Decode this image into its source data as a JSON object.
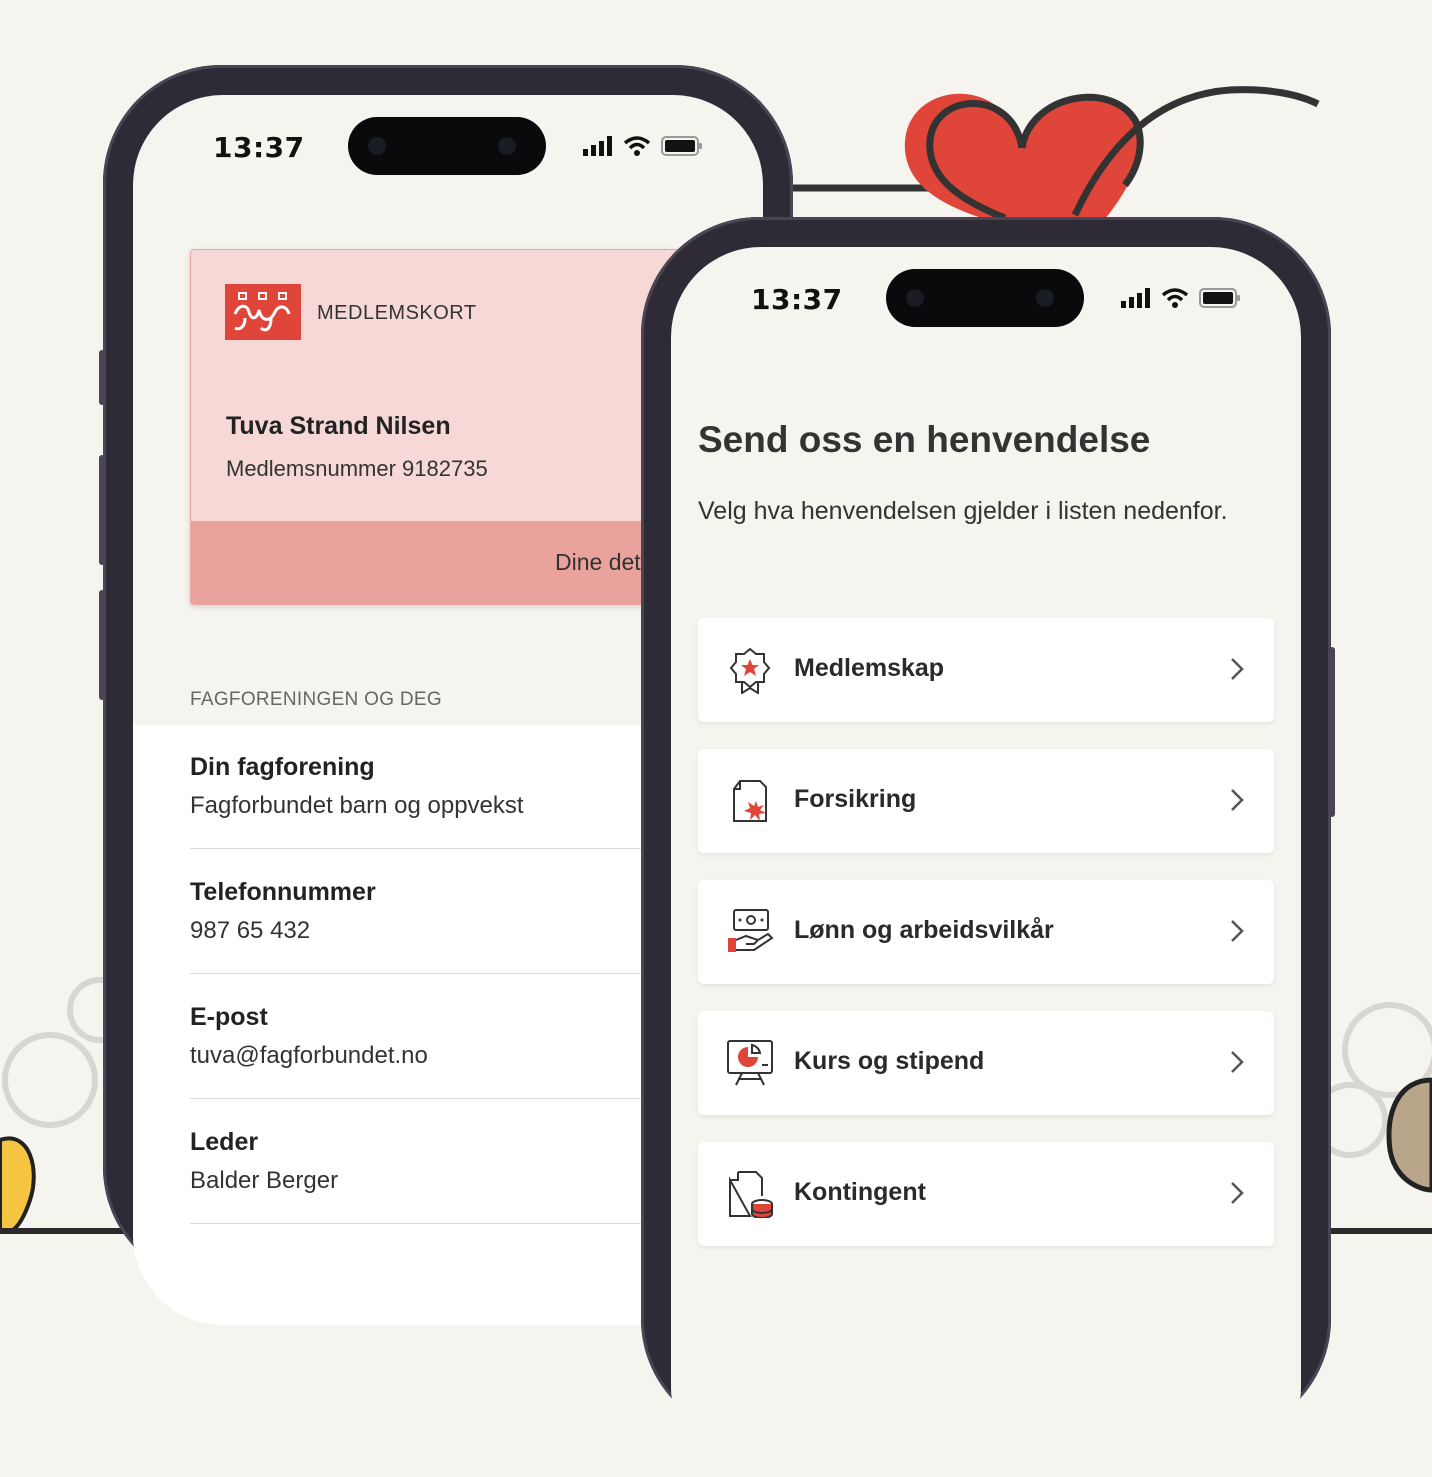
{
  "colors": {
    "accent": "#e0453a",
    "card_bg": "#f6d8d7",
    "card_footer": "#eaa29c",
    "background": "#f6f4ef",
    "phone_frame": "#2e2a36"
  },
  "phone_left": {
    "status_time": "13:37",
    "membership_card": {
      "label": "MEDLEMSKORT",
      "name": "Tuva Strand Nilsen",
      "member_number": "Medlemsnummer 9182735",
      "footer_link": "Dine detalj"
    },
    "section_heading": "FAGFORENINGEN OG DEG",
    "rows": [
      {
        "label": "Din fagforening",
        "value": "Fagforbundet barn og oppvekst"
      },
      {
        "label": "Telefonnummer",
        "value": "987 65 432"
      },
      {
        "label": "E-post",
        "value": "tuva@fagforbundet.no"
      },
      {
        "label": "Leder",
        "value": "Balder Berger"
      }
    ]
  },
  "phone_right": {
    "status_time": "13:37",
    "title": "Send oss en henvendelse",
    "subtitle": "Velg hva henvendelsen gjelder i listen nedenfor.",
    "items": [
      {
        "label": "Medlemskap",
        "icon": "award-badge-icon"
      },
      {
        "label": "Forsikring",
        "icon": "insurance-document-icon"
      },
      {
        "label": "Lønn og arbeidsvilkår",
        "icon": "salary-hand-icon"
      },
      {
        "label": "Kurs og stipend",
        "icon": "presentation-board-icon"
      },
      {
        "label": "Kontingent",
        "icon": "fee-document-coins-icon"
      }
    ]
  }
}
